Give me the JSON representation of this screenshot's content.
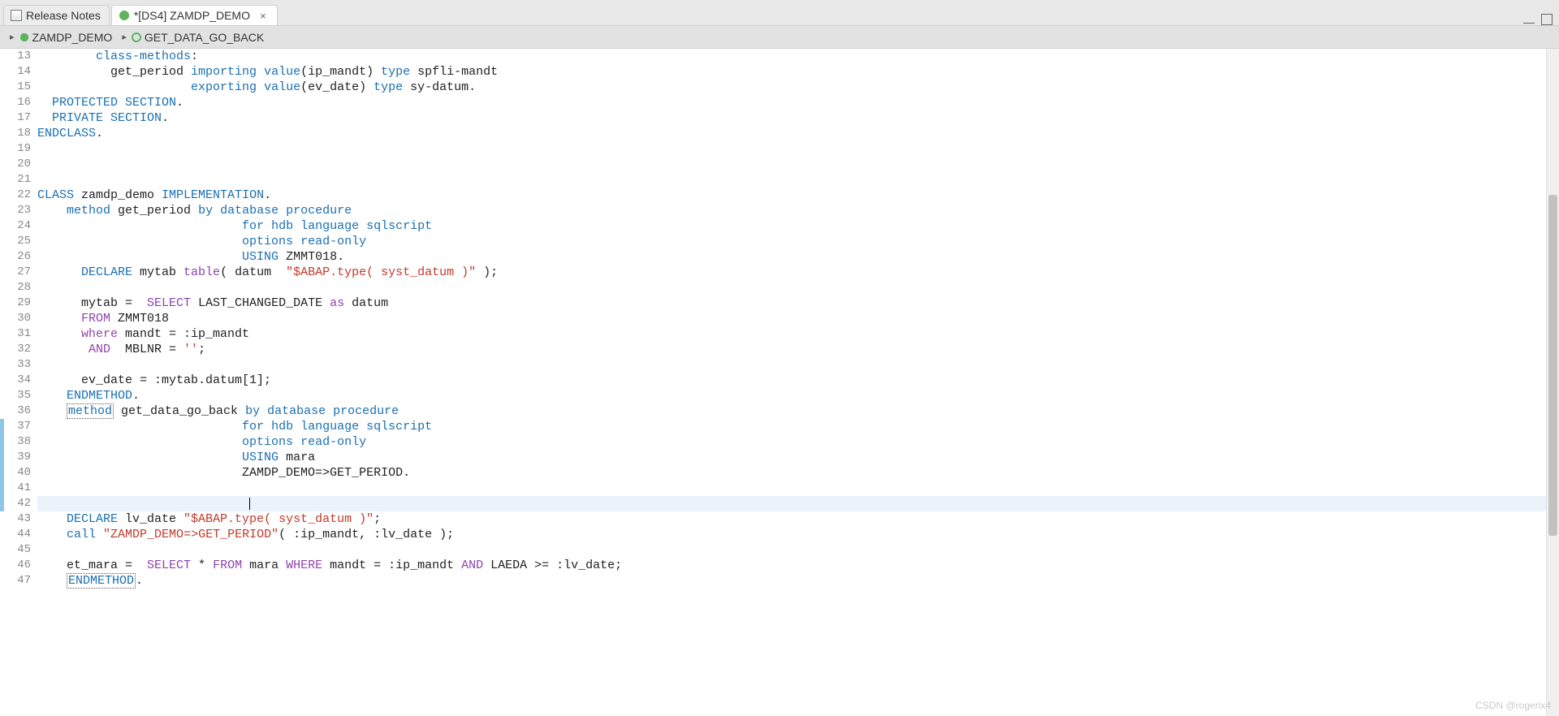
{
  "tabs": [
    {
      "label": "Release Notes",
      "icon": "release-notes-icon",
      "active": false,
      "dirty": false
    },
    {
      "label": "*[DS4] ZAMDP_DEMO",
      "icon": "abap-class-icon",
      "active": true,
      "dirty": true
    }
  ],
  "breadcrumb": [
    {
      "label": "ZAMDP_DEMO",
      "icon": "abap-class-icon"
    },
    {
      "label": "GET_DATA_GO_BACK",
      "icon": "abap-method-icon"
    }
  ],
  "editor": {
    "first_line_number": 13,
    "current_line_index": 29,
    "change_marker_ranges": [
      [
        24,
        29
      ]
    ],
    "lines": [
      {
        "tokens": [
          [
            "        ",
            ""
          ],
          [
            "class-methods",
            "kw"
          ],
          [
            ":",
            ""
          ]
        ]
      },
      {
        "tokens": [
          [
            "          ",
            ""
          ],
          [
            "get_period ",
            ""
          ],
          [
            "importing",
            "kw"
          ],
          [
            " ",
            ""
          ],
          [
            "value",
            "kw"
          ],
          [
            "(ip_mandt) ",
            ""
          ],
          [
            "type",
            "kw"
          ],
          [
            " spfli-mandt",
            ""
          ]
        ]
      },
      {
        "tokens": [
          [
            "                     ",
            ""
          ],
          [
            "exporting",
            "kw"
          ],
          [
            " ",
            ""
          ],
          [
            "value",
            "kw"
          ],
          [
            "(ev_date) ",
            ""
          ],
          [
            "type",
            "kw"
          ],
          [
            " sy-datum.",
            ""
          ]
        ]
      },
      {
        "tokens": [
          [
            "  ",
            ""
          ],
          [
            "PROTECTED SECTION",
            "kw"
          ],
          [
            ".",
            ""
          ]
        ]
      },
      {
        "tokens": [
          [
            "  ",
            ""
          ],
          [
            "PRIVATE SECTION",
            "kw"
          ],
          [
            ".",
            ""
          ]
        ]
      },
      {
        "tokens": [
          [
            "ENDCLASS",
            "kw"
          ],
          [
            ".",
            ""
          ]
        ]
      },
      {
        "tokens": [
          [
            "",
            ""
          ]
        ]
      },
      {
        "tokens": [
          [
            "",
            ""
          ]
        ]
      },
      {
        "tokens": [
          [
            "",
            ""
          ]
        ]
      },
      {
        "tokens": [
          [
            "CLASS",
            "kw"
          ],
          [
            " zamdp_demo ",
            ""
          ],
          [
            "IMPLEMENTATION",
            "kw"
          ],
          [
            ".",
            ""
          ]
        ]
      },
      {
        "tokens": [
          [
            "    ",
            ""
          ],
          [
            "method",
            "kw"
          ],
          [
            " get_period ",
            ""
          ],
          [
            "by",
            "kw"
          ],
          [
            " ",
            ""
          ],
          [
            "database",
            "kw"
          ],
          [
            " ",
            ""
          ],
          [
            "procedure",
            "kw"
          ]
        ]
      },
      {
        "tokens": [
          [
            "                            ",
            ""
          ],
          [
            "for",
            "kw"
          ],
          [
            " ",
            ""
          ],
          [
            "hdb",
            "kw"
          ],
          [
            " ",
            ""
          ],
          [
            "language",
            "kw"
          ],
          [
            " ",
            ""
          ],
          [
            "sqlscript",
            "kw"
          ]
        ]
      },
      {
        "tokens": [
          [
            "                            ",
            ""
          ],
          [
            "options",
            "kw"
          ],
          [
            " ",
            ""
          ],
          [
            "read-only",
            "kw"
          ]
        ]
      },
      {
        "tokens": [
          [
            "                            ",
            ""
          ],
          [
            "USING",
            "kw"
          ],
          [
            " ZMMT018.",
            ""
          ]
        ]
      },
      {
        "tokens": [
          [
            "      ",
            ""
          ],
          [
            "DECLARE",
            "kw"
          ],
          [
            " mytab ",
            ""
          ],
          [
            "table",
            "sql"
          ],
          [
            "( datum  ",
            ""
          ],
          [
            "\"$ABAP.type( syst_datum )\"",
            "str"
          ],
          [
            " );",
            ""
          ]
        ]
      },
      {
        "tokens": [
          [
            "",
            ""
          ]
        ]
      },
      {
        "tokens": [
          [
            "      mytab =  ",
            ""
          ],
          [
            "SELECT",
            "sql"
          ],
          [
            " LAST_CHANGED_DATE ",
            ""
          ],
          [
            "as",
            "sql"
          ],
          [
            " datum",
            ""
          ]
        ]
      },
      {
        "tokens": [
          [
            "      ",
            ""
          ],
          [
            "FROM",
            "sql"
          ],
          [
            " ZMMT018",
            ""
          ]
        ]
      },
      {
        "tokens": [
          [
            "      ",
            ""
          ],
          [
            "where",
            "sql"
          ],
          [
            " mandt = :ip_mandt",
            ""
          ]
        ]
      },
      {
        "tokens": [
          [
            "       ",
            ""
          ],
          [
            "AND",
            "sql"
          ],
          [
            "  MBLNR = ",
            ""
          ],
          [
            "''",
            "str"
          ],
          [
            ";",
            ""
          ]
        ]
      },
      {
        "tokens": [
          [
            "",
            ""
          ]
        ]
      },
      {
        "tokens": [
          [
            "      ev_date = :mytab.datum[1];",
            ""
          ]
        ]
      },
      {
        "tokens": [
          [
            "    ",
            ""
          ],
          [
            "ENDMETHOD",
            "kw"
          ],
          [
            ".",
            ""
          ]
        ]
      },
      {
        "tokens": [
          [
            "    ",
            ""
          ],
          [
            "method",
            "kw-boxed"
          ],
          [
            " get_data_go_back ",
            ""
          ],
          [
            "by",
            "kw"
          ],
          [
            " ",
            ""
          ],
          [
            "database",
            "kw"
          ],
          [
            " ",
            ""
          ],
          [
            "procedure",
            "kw"
          ]
        ]
      },
      {
        "tokens": [
          [
            "                            ",
            ""
          ],
          [
            "for",
            "kw"
          ],
          [
            " ",
            ""
          ],
          [
            "hdb",
            "kw"
          ],
          [
            " ",
            ""
          ],
          [
            "language",
            "kw"
          ],
          [
            " ",
            ""
          ],
          [
            "sqlscript",
            "kw"
          ]
        ]
      },
      {
        "tokens": [
          [
            "                            ",
            ""
          ],
          [
            "options",
            "kw"
          ],
          [
            " ",
            ""
          ],
          [
            "read-only",
            "kw"
          ]
        ]
      },
      {
        "tokens": [
          [
            "                            ",
            ""
          ],
          [
            "USING",
            "kw"
          ],
          [
            " mara",
            ""
          ]
        ]
      },
      {
        "tokens": [
          [
            "                            ZAMDP_DEMO=>GET_PERIOD.",
            ""
          ]
        ]
      },
      {
        "tokens": [
          [
            "",
            ""
          ]
        ]
      },
      {
        "tokens": [
          [
            "",
            ""
          ]
        ],
        "current": true
      },
      {
        "tokens": [
          [
            "    ",
            ""
          ],
          [
            "DECLARE",
            "kw"
          ],
          [
            " lv_date ",
            ""
          ],
          [
            "\"$ABAP.type( syst_datum )\"",
            "str"
          ],
          [
            ";",
            ""
          ]
        ]
      },
      {
        "tokens": [
          [
            "    ",
            ""
          ],
          [
            "call",
            "kw"
          ],
          [
            " ",
            ""
          ],
          [
            "\"ZAMDP_DEMO=>GET_PERIOD\"",
            "str"
          ],
          [
            "( :ip_mandt, :lv_date );",
            ""
          ]
        ]
      },
      {
        "tokens": [
          [
            "",
            ""
          ]
        ]
      },
      {
        "tokens": [
          [
            "    et_mara =  ",
            ""
          ],
          [
            "SELECT",
            "sql"
          ],
          [
            " * ",
            ""
          ],
          [
            "FROM",
            "sql"
          ],
          [
            " mara ",
            ""
          ],
          [
            "WHERE",
            "sql"
          ],
          [
            " mandt = :ip_mandt ",
            ""
          ],
          [
            "AND",
            "sql"
          ],
          [
            " LAEDA >= :lv_date;",
            ""
          ]
        ]
      },
      {
        "tokens": [
          [
            "    ",
            ""
          ],
          [
            "ENDMETHOD",
            "kw-boxed"
          ],
          [
            ".",
            ""
          ]
        ]
      }
    ]
  },
  "watermark": "CSDN @rogerix4"
}
